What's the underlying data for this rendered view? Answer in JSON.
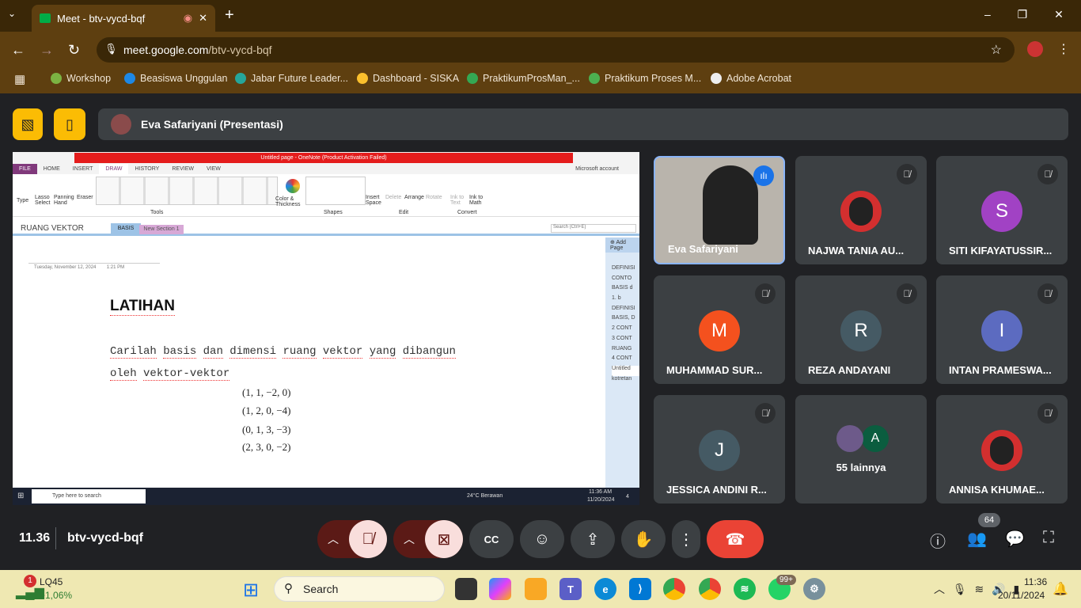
{
  "browser": {
    "tab_title": "Meet - btv-vycd-bqf",
    "url_host": "meet.google.com",
    "url_path": "/btv-vycd-bqf",
    "bookmarks": [
      "Workshop",
      "Beasiswa Unggulan",
      "Jabar Future Leader...",
      "Dashboard - SISKA",
      "PraktikumProsMan_...",
      "Praktikum Proses M...",
      "Adobe Acrobat"
    ]
  },
  "presenter": {
    "label": "Eva Safariyani (Presentasi)"
  },
  "onenote": {
    "title": "Untitled page - OneNote (Product Activation Failed)",
    "ribbon_tabs": [
      "FILE",
      "HOME",
      "INSERT",
      "DRAW",
      "HISTORY",
      "REVIEW",
      "VIEW"
    ],
    "active_tab": "DRAW",
    "account": "Microsoft account",
    "tools": [
      "Type",
      "Lasso Select",
      "Panning Hand",
      "Eraser"
    ],
    "color_thickness": "Color & Thickness",
    "groups": [
      "Tools",
      "Shapes",
      "Edit",
      "Convert"
    ],
    "edit": [
      "Insert Space",
      "Delete",
      "Arrange",
      "Rotate"
    ],
    "convert": [
      "Ink to Text",
      "Ink to Math"
    ],
    "notebook": "RUANG VEKTOR",
    "sections": [
      "BASIS",
      "New Section 1"
    ],
    "search_placeholder": "Search (Ctrl+E)",
    "add_page": "Add Page",
    "date": "Tuesday, November 12, 2024",
    "time": "1:21 PM",
    "heading": "LATIHAN",
    "line1": [
      "Carilah",
      "basis",
      "dan",
      "dimensi",
      "ruang",
      "vektor",
      "yang",
      "dibangun"
    ],
    "line2": [
      "oleh",
      "vektor-vektor"
    ],
    "vectors": [
      "(1, 1, −2, 0)",
      "(1, 2, 0, −4)",
      "(0, 1, 3, −3)",
      "(2, 3, 0, −2)"
    ],
    "pages": [
      "DEFINISI",
      "CONTO",
      "BASIS d",
      "1. b",
      "DEFINISI",
      "BASIS, D",
      "2 CONT",
      "3 CONT",
      "RUANG",
      "4 CONT",
      "Untitled",
      "kotretan"
    ],
    "taskbar": {
      "search": "Type here to search",
      "weather": "24°C  Berawan",
      "time": "11:36 AM",
      "date": "11/20/2024",
      "notif": "4"
    }
  },
  "participants": [
    {
      "name": "Eva Safariyani",
      "speaking": true
    },
    {
      "name": "NAJWA TANIA AU...",
      "muted": true
    },
    {
      "name": "SITI KIFAYATUSSIR...",
      "initial": "S",
      "color": "#a142c4",
      "muted": true
    },
    {
      "name": "MUHAMMAD SUR...",
      "initial": "M",
      "color": "#f4511e",
      "muted": true
    },
    {
      "name": "REZA ANDAYANI",
      "initial": "R",
      "color": "#455a64",
      "muted": true
    },
    {
      "name": "INTAN PRAMESWA...",
      "initial": "I",
      "color": "#5c6bc0",
      "muted": true
    },
    {
      "name": "JESSICA ANDINI R...",
      "initial": "J",
      "color": "#455a64",
      "muted": true
    },
    {
      "name": "55 lainnya",
      "initial": "A",
      "color": "#0b5d3f"
    },
    {
      "name": "ANNISA KHUMAE...",
      "muted": true
    }
  ],
  "meeting": {
    "time": "11.36",
    "code": "btv-vycd-bqf",
    "people_count": "64"
  },
  "os_taskbar": {
    "stock": "LQ45",
    "stock_change": "+1,06%",
    "stock_badge": "1",
    "search": "Search",
    "whatsapp_badge": "99+",
    "time": "11:36",
    "date": "20/11/2024"
  },
  "colors": {
    "accent": "#fbbc04",
    "end_call": "#ea4335",
    "mic_off": "#f9dedc"
  }
}
